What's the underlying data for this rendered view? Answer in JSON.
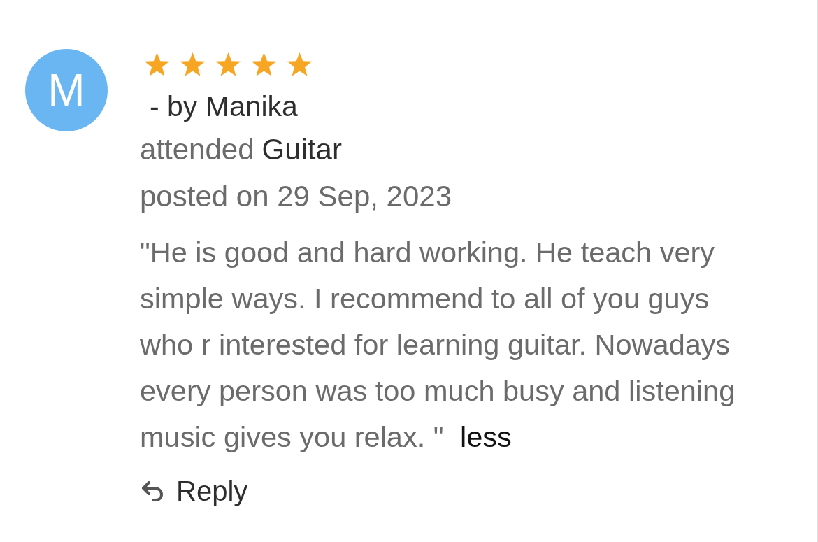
{
  "review": {
    "avatar": {
      "initial": "M"
    },
    "stars": 5,
    "author": "- by Manika",
    "attended_label": "attended",
    "course": "Guitar",
    "posted": "posted on 29 Sep, 2023",
    "text": "\"He is good and hard working. He teach very simple ways. I recommend to all of you guys who r interested for learning guitar. Nowadays every person was too much busy and listening music gives you relax. \"",
    "less_link": "less",
    "reply_button": "Reply"
  }
}
